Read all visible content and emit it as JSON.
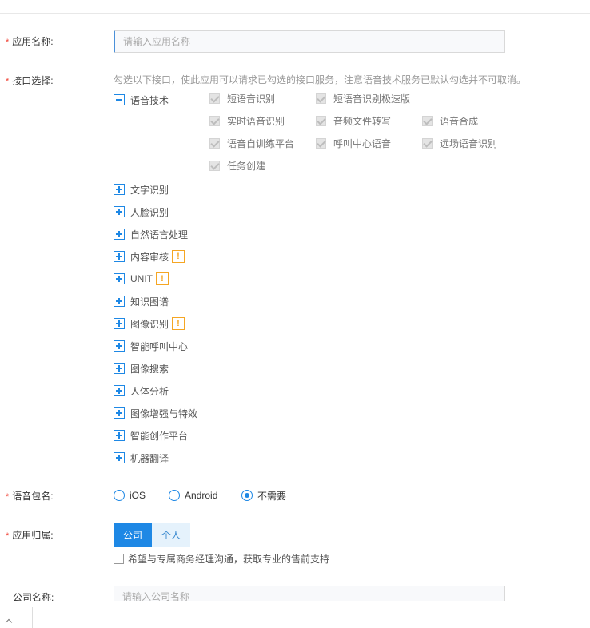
{
  "form": {
    "app_name": {
      "required_mark": "*",
      "label": "应用名称:",
      "placeholder": "请输入应用名称"
    },
    "api_select": {
      "required_mark": "*",
      "label": "接口选择:",
      "hint": "勾选以下接口，使此应用可以请求已勾选的接口服务，注意语音技术服务已默认勾选并不可取消。",
      "expanded_group": {
        "label": "语音技术",
        "items": [
          "短语音识别",
          "短语音识别极速版",
          "实时语音识别",
          "音频文件转写",
          "语音合成",
          "语音自训练平台",
          "呼叫中心语音",
          "远场语音识别",
          "任务创建"
        ]
      },
      "groups": [
        {
          "label": "文字识别",
          "warn": ""
        },
        {
          "label": "人脸识别",
          "warn": ""
        },
        {
          "label": "自然语言处理",
          "warn": ""
        },
        {
          "label": "内容审核",
          "warn": "!"
        },
        {
          "label": "UNIT",
          "warn": "!"
        },
        {
          "label": "知识图谱",
          "warn": ""
        },
        {
          "label": "图像识别",
          "warn": "!"
        },
        {
          "label": "智能呼叫中心",
          "warn": ""
        },
        {
          "label": "图像搜索",
          "warn": ""
        },
        {
          "label": "人体分析",
          "warn": ""
        },
        {
          "label": "图像增强与特效",
          "warn": ""
        },
        {
          "label": "智能创作平台",
          "warn": ""
        },
        {
          "label": "机器翻译",
          "warn": ""
        }
      ]
    },
    "package_name": {
      "required_mark": "*",
      "label": "语音包名:",
      "options": [
        "iOS",
        "Android",
        "不需要"
      ],
      "selected": "不需要"
    },
    "app_owner": {
      "required_mark": "*",
      "label": "应用归属:",
      "options": [
        "公司",
        "个人"
      ],
      "selected": "公司",
      "consult_checkbox": "希望与专属商务经理沟通，获取专业的售前支持"
    },
    "company_name": {
      "label": "公司名称:",
      "placeholder": "请输入公司名称"
    }
  },
  "colors": {
    "accent": "#1e88e5",
    "required": "#f04134",
    "warning": "#f5a623"
  }
}
